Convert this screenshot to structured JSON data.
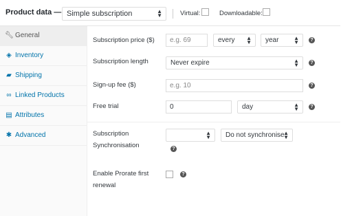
{
  "header": {
    "title": "Product data —",
    "product_type": "Simple subscription",
    "virtual_label": "Virtual:",
    "downloadable_label": "Downloadable:"
  },
  "tabs": [
    {
      "label": "General",
      "icon": "wrench-icon"
    },
    {
      "label": "Inventory",
      "icon": "tag-icon"
    },
    {
      "label": "Shipping",
      "icon": "truck-icon"
    },
    {
      "label": "Linked Products",
      "icon": "link-icon"
    },
    {
      "label": "Attributes",
      "icon": "list-icon"
    },
    {
      "label": "Advanced",
      "icon": "gear-icon"
    }
  ],
  "fields": {
    "price": {
      "label": "Subscription price ($)",
      "placeholder": "e.g. 69",
      "interval": "every",
      "period": "year"
    },
    "length": {
      "label": "Subscription length",
      "value": "Never expire"
    },
    "signup": {
      "label": "Sign-up fee ($)",
      "placeholder": "e.g. 10"
    },
    "trial": {
      "label": "Free trial",
      "value": "0",
      "period": "day"
    },
    "sync": {
      "label_line1": "Subscription",
      "label_line2": "Synchronisation",
      "option": "Do not synchronise"
    },
    "prorate": {
      "label_line1": "Enable Prorate first",
      "label_line2": "renewal"
    }
  },
  "colors": {
    "link": "#0073aa",
    "border": "#dddddd",
    "help": "#555555"
  }
}
